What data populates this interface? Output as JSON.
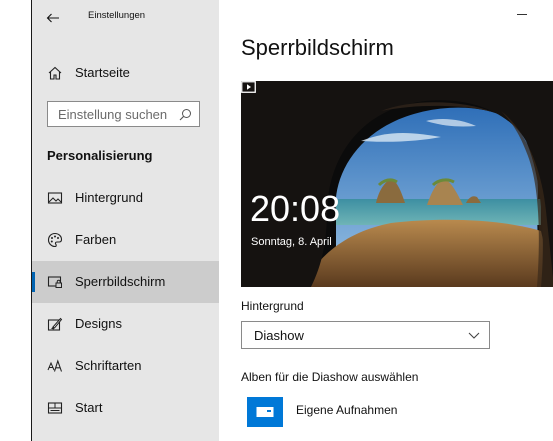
{
  "window": {
    "title": "Einstellungen"
  },
  "sidebar": {
    "home_label": "Startseite",
    "search": {
      "placeholder": "Einstellung suchen"
    },
    "section_heading": "Personalisierung",
    "items": [
      {
        "label": "Hintergrund",
        "icon": "picture-icon"
      },
      {
        "label": "Farben",
        "icon": "palette-icon"
      },
      {
        "label": "Sperrbildschirm",
        "icon": "lock-screen-icon",
        "active": true
      },
      {
        "label": "Designs",
        "icon": "brush-icon"
      },
      {
        "label": "Schriftarten",
        "icon": "font-icon"
      },
      {
        "label": "Start",
        "icon": "start-icon"
      }
    ]
  },
  "main": {
    "title": "Sperrbildschirm",
    "preview": {
      "time": "20:08",
      "date": "Sonntag, 8. April"
    },
    "background_label": "Hintergrund",
    "background_value": "Diashow",
    "album_label": "Alben für die Diashow auswählen",
    "album_name": "Eigene Aufnahmen"
  },
  "colors": {
    "accent": "#0063b1",
    "album_tile": "#0078d7",
    "sidebar_bg": "#e6e6e6",
    "active_bg": "#cccccc"
  }
}
